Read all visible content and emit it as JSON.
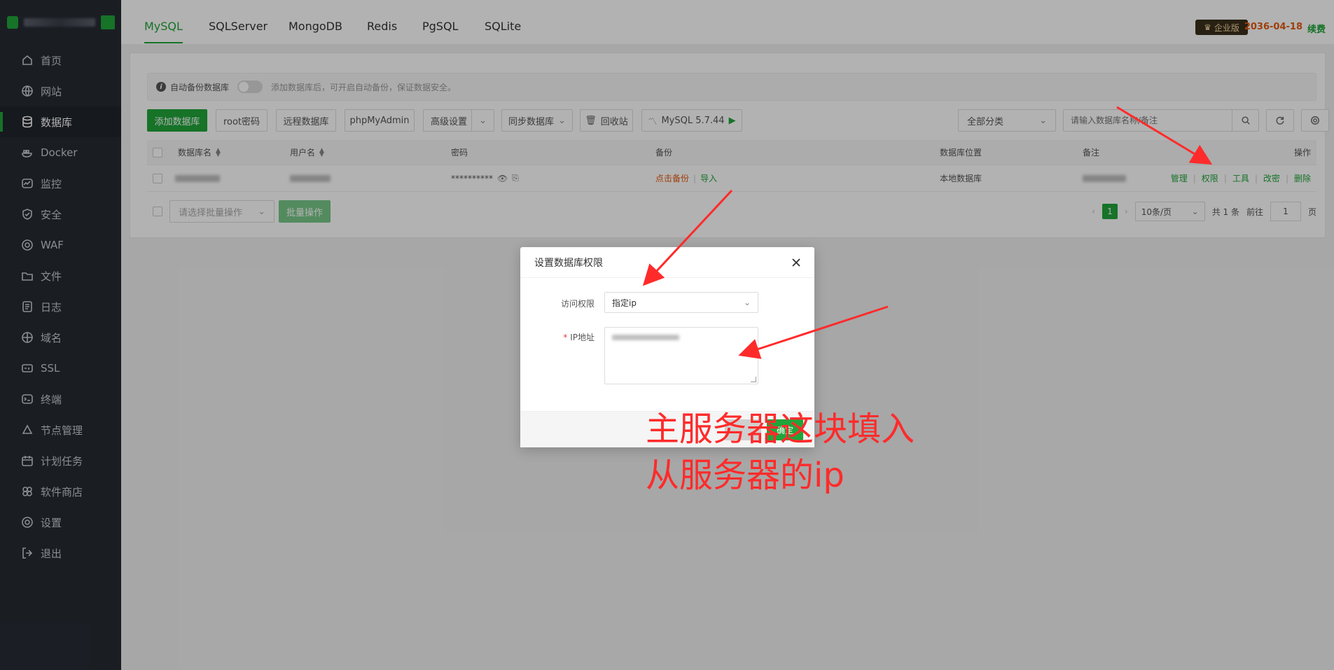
{
  "sidebar": {
    "items": [
      {
        "label": "首页",
        "icon": "home-icon"
      },
      {
        "label": "网站",
        "icon": "globe-icon"
      },
      {
        "label": "数据库",
        "icon": "database-icon",
        "active": true
      },
      {
        "label": "Docker",
        "icon": "docker-icon"
      },
      {
        "label": "监控",
        "icon": "monitor-icon"
      },
      {
        "label": "安全",
        "icon": "shield-icon"
      },
      {
        "label": "WAF",
        "icon": "waf-icon"
      },
      {
        "label": "文件",
        "icon": "folder-icon"
      },
      {
        "label": "日志",
        "icon": "log-icon"
      },
      {
        "label": "域名",
        "icon": "domain-icon"
      },
      {
        "label": "SSL",
        "icon": "ssl-icon"
      },
      {
        "label": "终端",
        "icon": "terminal-icon"
      },
      {
        "label": "节点管理",
        "icon": "nodes-icon"
      },
      {
        "label": "计划任务",
        "icon": "calendar-icon"
      },
      {
        "label": "软件商店",
        "icon": "store-icon"
      },
      {
        "label": "设置",
        "icon": "gear-icon"
      },
      {
        "label": "退出",
        "icon": "logout-icon"
      }
    ]
  },
  "header": {
    "tabs": [
      "MySQL",
      "SQLServer",
      "MongoDB",
      "Redis",
      "PgSQL",
      "SQLite"
    ],
    "edition": "企业版",
    "expire_date": "2036-04-18",
    "renew": "续费"
  },
  "tip": {
    "label": "自动备份数据库",
    "text": "添加数据库后，可开启自动备份，保证数据安全。"
  },
  "toolbar": {
    "add_db": "添加数据库",
    "root_pwd": "root密码",
    "remote_db": "远程数据库",
    "phpmyadmin": "phpMyAdmin",
    "advanced": "高级设置",
    "sync": "同步数据库",
    "recycle": "回收站",
    "mysql_version": "MySQL 5.7.44",
    "category": "全部分类",
    "search_placeholder": "请输入数据库名称/备注"
  },
  "table": {
    "headers": {
      "name": "数据库名",
      "user": "用户名",
      "password": "密码",
      "backup": "备份",
      "location": "数据库位置",
      "remark": "备注",
      "ops": "操作"
    },
    "row": {
      "password": "**********",
      "backup_click": "点击备份",
      "backup_sep": "|",
      "import": "导入",
      "location": "本地数据库",
      "ops": [
        "管理",
        "权限",
        "工具",
        "改密",
        "删除"
      ]
    }
  },
  "batch": {
    "placeholder": "请选择批量操作",
    "button": "批量操作"
  },
  "pager": {
    "current": "1",
    "size": "10条/页",
    "total": "共 1 条",
    "goto": "前往",
    "page_input": "1",
    "page_unit": "页"
  },
  "modal": {
    "title": "设置数据库权限",
    "access_label": "访问权限",
    "access_value": "指定ip",
    "ip_label": "IP地址",
    "required_mark": "*",
    "ok": "确定"
  },
  "annotation": {
    "line1": "主服务器这块填入",
    "line2": "从服务器的ip",
    "color": "#ff2b2b"
  },
  "colors": {
    "accent": "#20a53a",
    "sidebar_bg": "#262b33",
    "warning": "#e35a10"
  }
}
